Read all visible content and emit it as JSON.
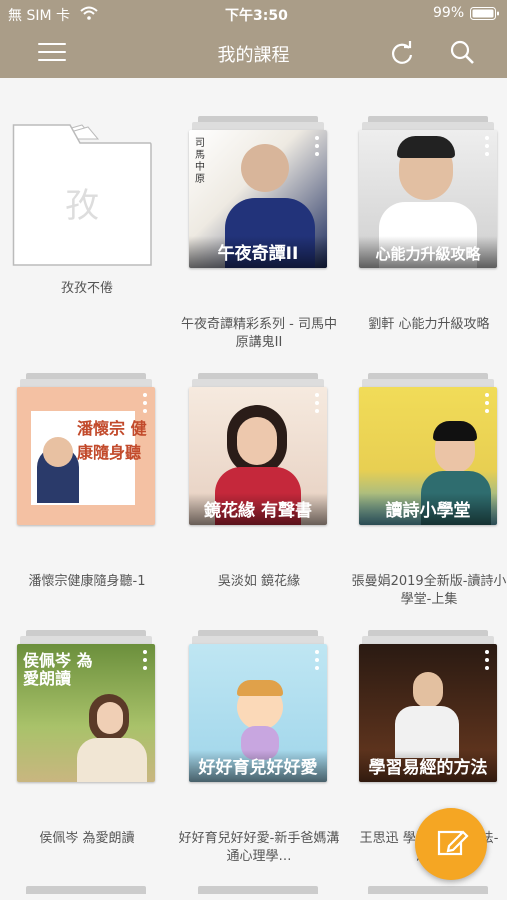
{
  "status_bar": {
    "carrier": "無 SIM 卡",
    "time": "下午3:50",
    "battery": "99%"
  },
  "header": {
    "title": "我的課程"
  },
  "folder": {
    "glyph": "孜",
    "label": "孜孜不倦"
  },
  "courses": [
    {
      "cover_title": "午夜奇譚II",
      "label": "午夜奇譚精彩系列 - 司馬中原講鬼II"
    },
    {
      "cover_title": "心能力升級攻略",
      "label": "劉軒 心能力升級攻略"
    },
    {
      "cover_title": "潘懷宗 健康隨身聽",
      "label": "潘懷宗健康隨身聽-1"
    },
    {
      "cover_title": "鏡花緣 有聲書",
      "label": "吳淡如 鏡花緣"
    },
    {
      "cover_title": "讀詩小學堂",
      "label": "張曼娟2019全新版-讀詩小學堂-上集"
    },
    {
      "cover_title": "侯佩岑 為愛朗讀",
      "label": "侯佩岑 為愛朗讀"
    },
    {
      "cover_title": "好好育兒好好愛",
      "label": "好好育兒好好愛-新手爸媽溝通心理學…"
    },
    {
      "cover_title": "學習易經的方法",
      "label": "王思迅 學習易經的方法-演…"
    }
  ],
  "colors": {
    "header": "#aa9d88",
    "fab": "#f5a623"
  }
}
